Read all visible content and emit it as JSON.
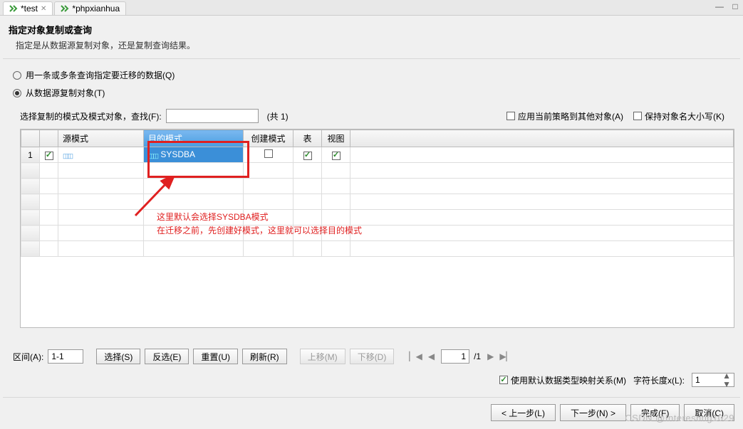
{
  "tabs": {
    "tab1": "*test",
    "tab2": "*phpxianhua"
  },
  "title": "指定对象复制或查询",
  "subtitle": "指定是从数据源复制对象，还是复制查询结果。",
  "radios": {
    "query": "用一条或多条查询指定要迁移的数据(Q)",
    "from_source": "从数据源复制对象(T)"
  },
  "find": {
    "label": "选择复制的模式及模式对象，查找(F):",
    "value": "",
    "count": "(共 1)"
  },
  "right_options": {
    "apply_policy": "应用当前策略到其他对象(A)",
    "keep_case": "保持对象名大小写(K)"
  },
  "table": {
    "headers": {
      "row": "",
      "check": "",
      "source_schema": "源模式",
      "dest_schema": "目的模式",
      "create_schema": "创建模式",
      "table_col": "表",
      "view_col": "视图"
    },
    "row1": {
      "num": "1",
      "dest": "SYSDBA"
    }
  },
  "annotation": {
    "line1": "这里默认会选择SYSDBA模式",
    "line2": "在迁移之前，先创建好模式，这里就可以选择目的模式"
  },
  "bottom": {
    "range_label": "区间(A):",
    "range_value": "1-1",
    "select": "选择(S)",
    "invert": "反选(E)",
    "reset": "重置(U)",
    "refresh": "刷新(R)",
    "move_up": "上移(M)",
    "move_down": "下移(D)",
    "page_value": "1",
    "page_total": "/1"
  },
  "bottom2": {
    "use_default_map": "使用默认数据类型映射关系(M)",
    "char_len_label": "字符长度x(L):",
    "char_len_value": "1"
  },
  "nav": {
    "prev": "< 上一步(L)",
    "next": "下一步(N) >",
    "finish": "完成(F)",
    "cancel": "取消(C)"
  },
  "watermark": "CSDN @Interesting1029"
}
